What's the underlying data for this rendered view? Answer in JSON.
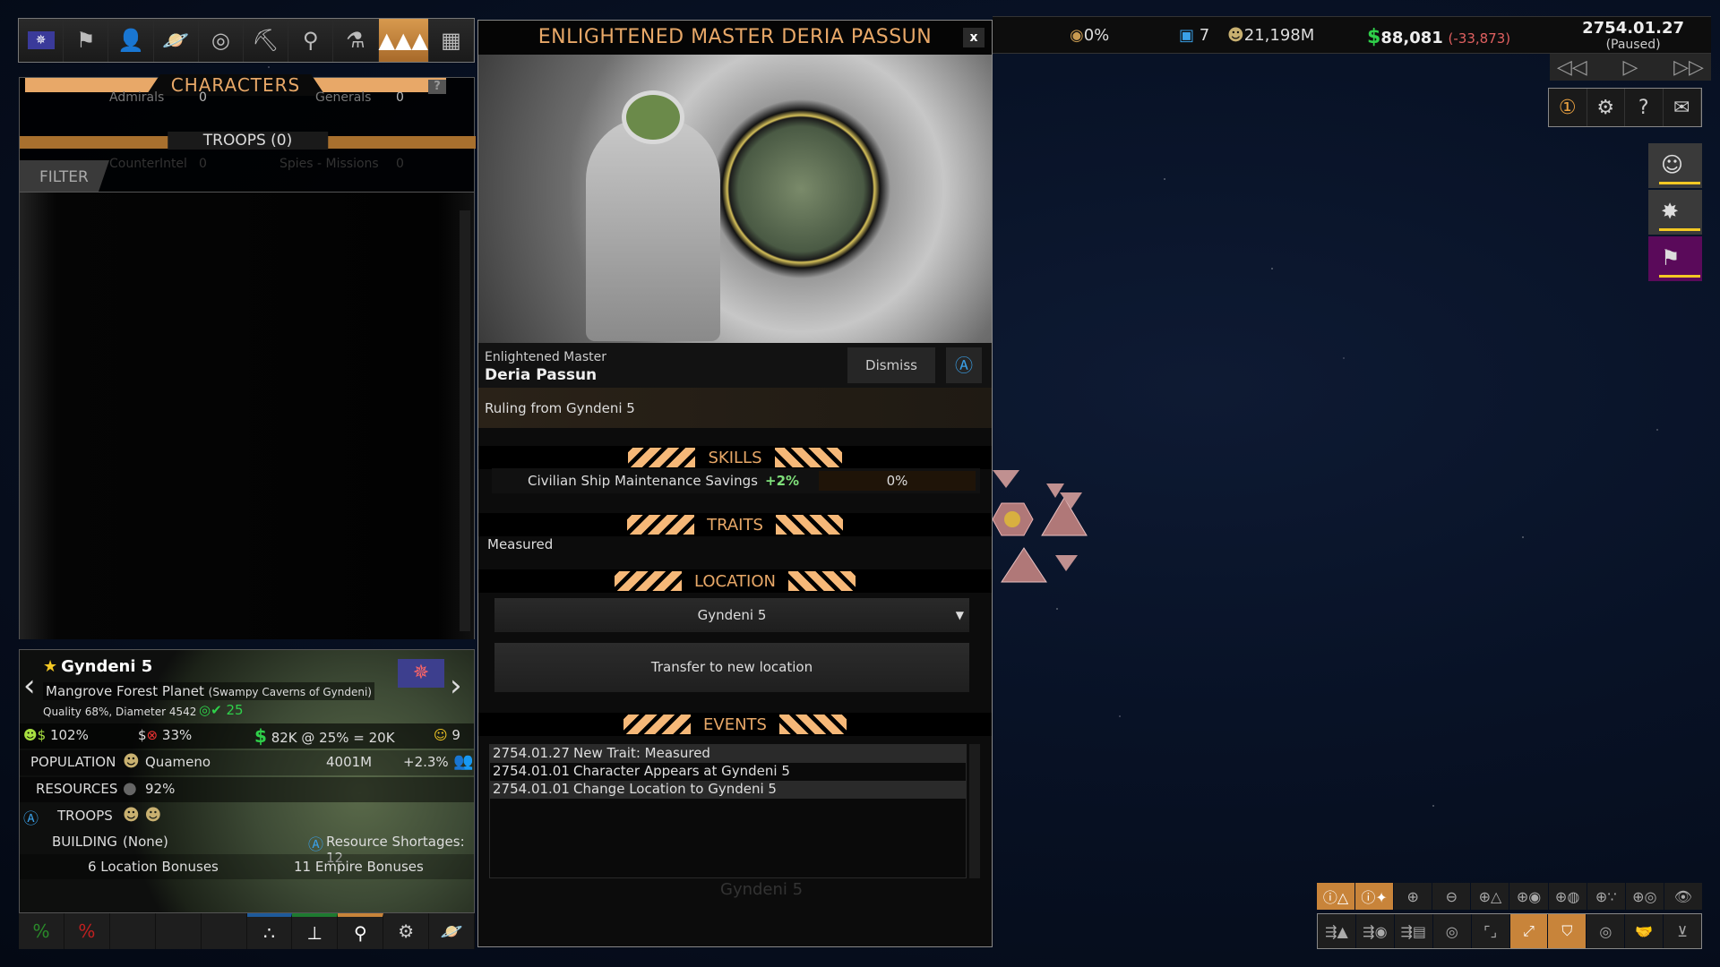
{
  "toolbar": {
    "items": [
      {
        "name": "empire-flag",
        "icon": "✵"
      },
      {
        "name": "diplomacy",
        "icon": "⚑"
      },
      {
        "name": "characters-person",
        "icon": "👤"
      },
      {
        "name": "colonies",
        "icon": "🪐"
      },
      {
        "name": "radar",
        "icon": "◎"
      },
      {
        "name": "mining",
        "icon": "⛏"
      },
      {
        "name": "construction-hook",
        "icon": "⚲"
      },
      {
        "name": "research",
        "icon": "⚗"
      },
      {
        "name": "characters",
        "icon": "▲▲▲",
        "active": true
      },
      {
        "name": "buildings",
        "icon": "▦"
      }
    ]
  },
  "characters_panel": {
    "title": "CHARACTERS",
    "help": "?",
    "ghost_rows": [
      {
        "label": "Admirals",
        "value": "0"
      },
      {
        "label": "Generals",
        "value": "0"
      },
      {
        "label": "CounterIntel",
        "value": "0"
      },
      {
        "label": "Spies - Missions",
        "value": "0"
      }
    ],
    "troops_label": "TROOPS (0)",
    "filter_label": "FILTER"
  },
  "planet": {
    "name": "Gyndeni 5",
    "type": "Mangrove Forest Planet",
    "subname": "(Swampy Caverns of Gyndeni)",
    "quality": "Quality 68%, Diameter 4542",
    "scan_value": "25",
    "happiness_pct": "102%",
    "tax_loss_pct": "33%",
    "income": "82K @ 25% = 20K",
    "mood_value": "9",
    "population_label": "POPULATION",
    "population_race": "Quameno",
    "population_value": "4001M",
    "population_growth": "+2.3%",
    "resources_label": "RESOURCES",
    "resources_value": "92%",
    "troops_label": "TROOPS",
    "building_label": "BUILDING",
    "building_value": "(None)",
    "shortages": "Resource Shortages: 12",
    "location_bonuses": "6 Location Bonuses",
    "empire_bonuses": "11 Empire Bonuses"
  },
  "planet_bar": {
    "buttons": [
      "%",
      "%",
      "",
      "",
      "",
      "∴",
      "⊥",
      "⚲",
      "⚙",
      "🪐"
    ]
  },
  "dialog": {
    "title": "ENLIGHTENED MASTER DERIA PASSUN",
    "close": "x",
    "role": "Enlightened Master",
    "name": "Deria Passun",
    "dismiss": "Dismiss",
    "auto_icon": "Ⓐ",
    "ruling": "Ruling from Gyndeni 5",
    "skills_header": "SKILLS",
    "skills": [
      {
        "name": "Civilian Ship Maintenance Savings",
        "bonus": "+2%",
        "progress": "0%"
      }
    ],
    "traits_header": "TRAITS",
    "traits": [
      "Measured"
    ],
    "location_header": "LOCATION",
    "location_selected": "Gyndeni 5",
    "transfer_button": "Transfer to new location",
    "events_header": "EVENTS",
    "events": [
      {
        "date": "2754.01.27",
        "text": "New Trait: Measured"
      },
      {
        "date": "2754.01.01",
        "text": "Character Appears at Gyndeni 5"
      },
      {
        "date": "2754.01.01",
        "text": "Change Location to Gyndeni 5"
      }
    ],
    "ghost_location": "Gyndeni 5"
  },
  "resources_bar": {
    "influence": "0%",
    "colonies": "7",
    "population": "21,198M",
    "money": "88,081",
    "money_delta": "(-33,873)",
    "date": "2754.01.27",
    "state": "(Paused)",
    "colors": {
      "money": "#2fd04a",
      "delta": "#e06060"
    }
  },
  "speed_controls": {
    "slower": "◁◁",
    "play": "▷",
    "faster": "▷▷"
  },
  "system_buttons": [
    "①",
    "⚙",
    "?",
    "✉"
  ],
  "notifications": [
    {
      "kind": "character",
      "glyph": "☺"
    },
    {
      "kind": "ship",
      "glyph": "✸"
    },
    {
      "kind": "colony-flag",
      "glyph": "⚑"
    }
  ],
  "map_toolbar_top": [
    "ⓘ△",
    "ⓘ✦",
    "⊕",
    "⊖",
    "⊕△",
    "⊕◉",
    "⊕◍",
    "⊕∵",
    "⊕◎",
    "👁"
  ],
  "map_toolbar_top_active": [
    0,
    1
  ],
  "map_toolbar_bottom": [
    "⇶▲",
    "⇶◉",
    "⇶▤",
    "◎",
    "⌜⌟",
    "⤢",
    "⛉",
    "◎",
    "🤝",
    "⊻"
  ],
  "map_toolbar_bottom_active": [
    5,
    6
  ]
}
